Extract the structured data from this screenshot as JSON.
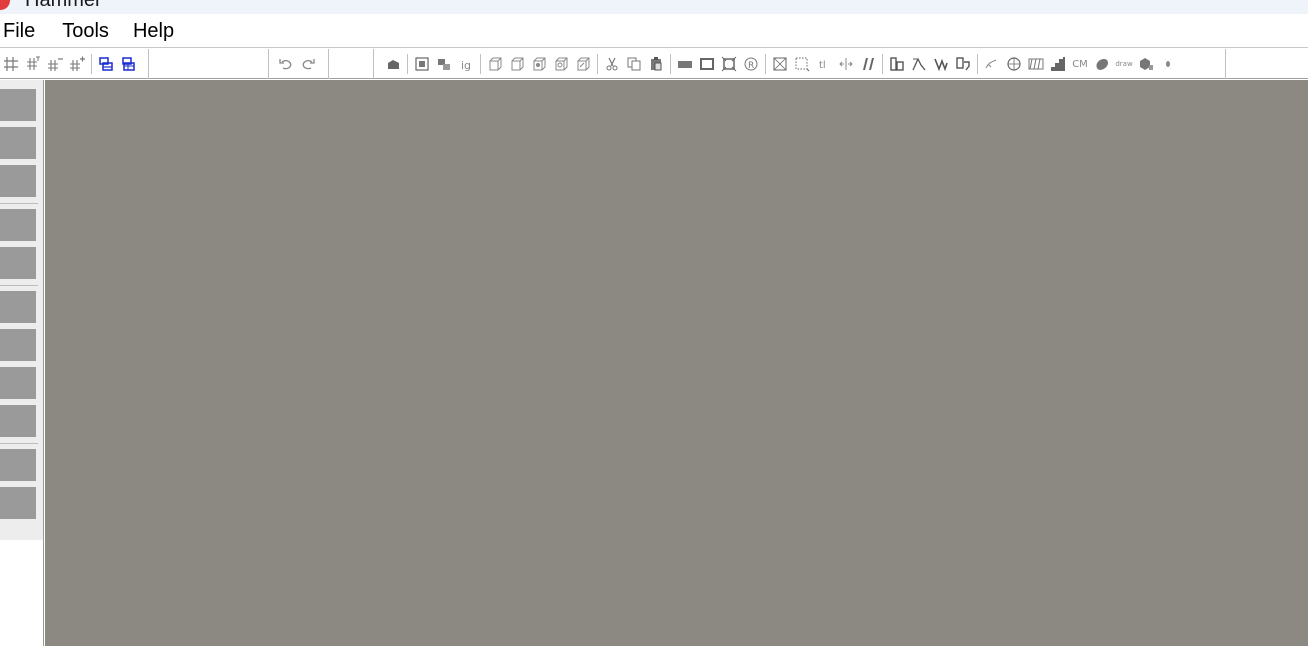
{
  "window": {
    "title": "Hammer"
  },
  "menu": {
    "items": [
      "File",
      "Tools",
      "Help"
    ]
  },
  "toolbar": {
    "grid_icons": [
      "grid-icon",
      "grid-smaller-icon",
      "grid-larger-icon",
      "grid-toggle-icon"
    ],
    "texture_lock_icons": [
      "texture-lock-icon",
      "texture-scale-lock-icon"
    ],
    "history_icons": [
      "undo-icon",
      "redo-icon"
    ],
    "cut_copy_paste_icons": [
      "cut-icon",
      "copy-icon",
      "paste-icon"
    ],
    "text_glyphs": {
      "cm_label": "CM",
      "draw_label": "draw"
    }
  },
  "left_tools": {
    "count": 11
  },
  "colors": {
    "workspace": "#8c8882",
    "tool_button": "#9a9a9a",
    "accent_blue": "#1a2ccf"
  }
}
